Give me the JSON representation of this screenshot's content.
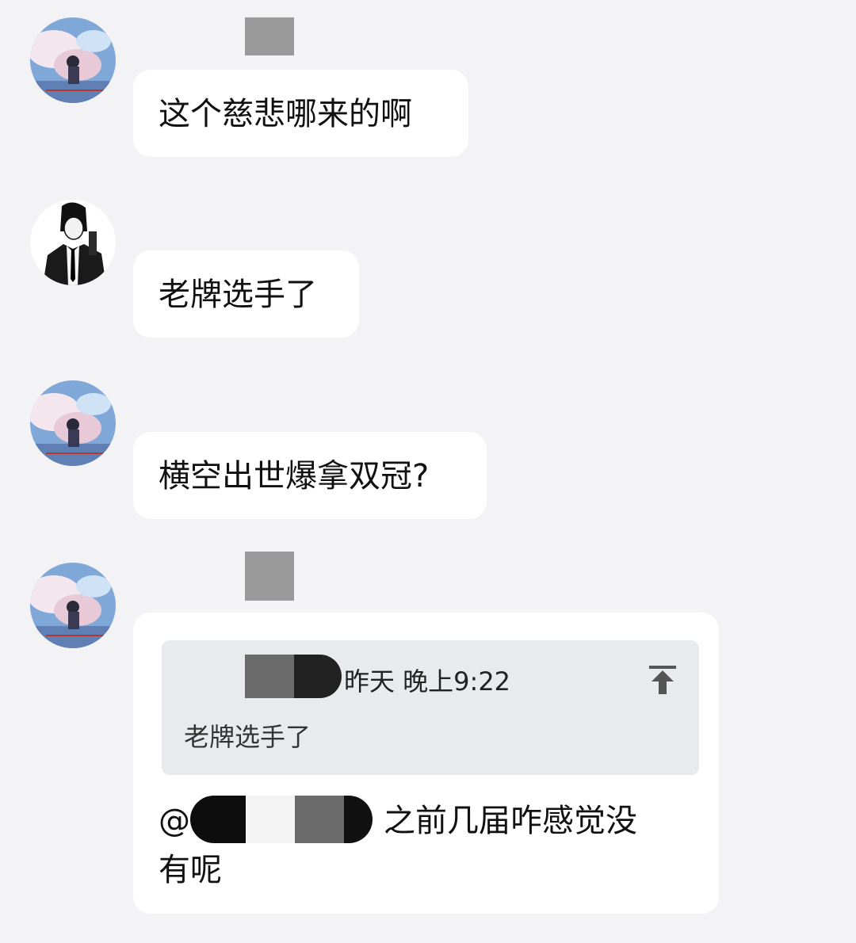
{
  "messages": [
    {
      "text": "这个慈悲哪来的啊"
    },
    {
      "text": "老牌选手了"
    },
    {
      "text": "横空出世爆拿双冠?"
    }
  ],
  "reply_message": {
    "quote": {
      "timestamp": "昨天 晚上9:22",
      "text": "老牌选手了",
      "icon": "scroll-to-top-icon"
    },
    "at_sign": "@",
    "line1_text": "之前几届咋感觉没",
    "line2_text": "有呢"
  },
  "colors": {
    "background": "#f3f3f5",
    "bubble": "#ffffff",
    "quote_background": "#e9eaed"
  }
}
